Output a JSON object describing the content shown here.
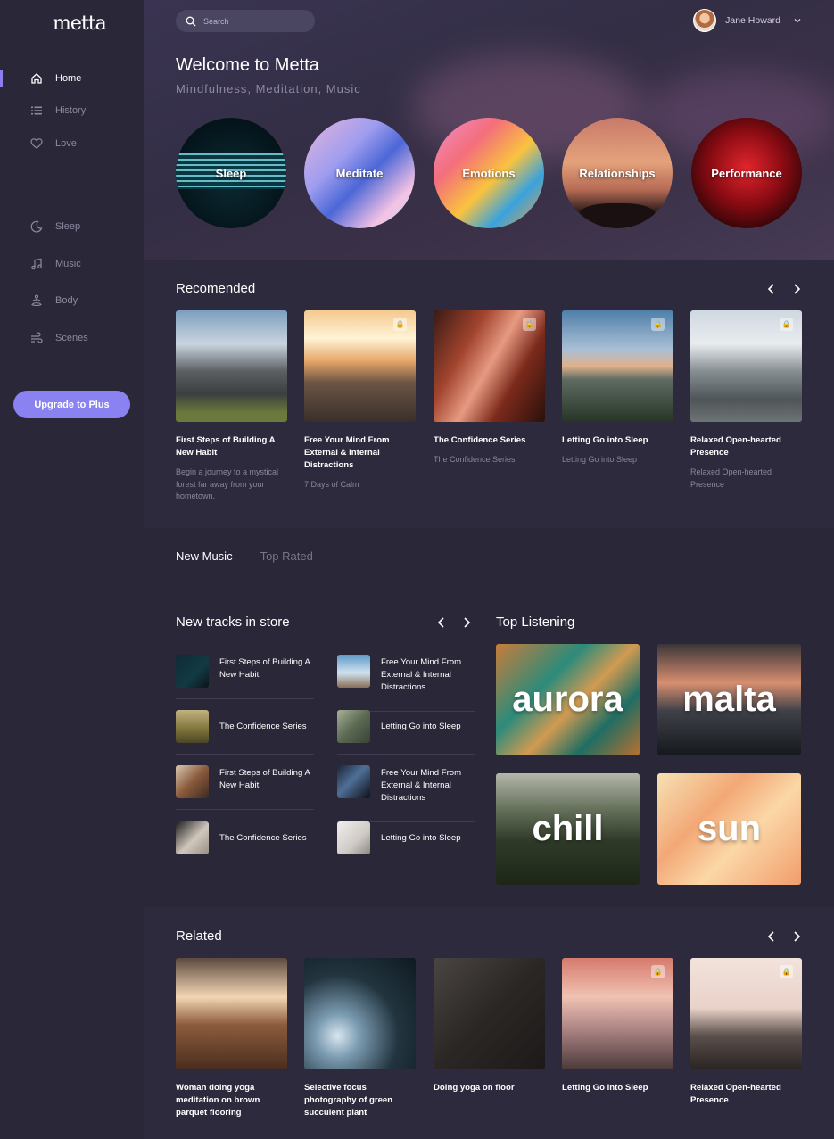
{
  "app": {
    "logo": "metta"
  },
  "sidebar": {
    "items": [
      {
        "label": "Home",
        "icon": "home-icon",
        "active": true
      },
      {
        "label": "History",
        "icon": "list-icon",
        "active": false
      },
      {
        "label": "Love",
        "icon": "heart-icon",
        "active": false
      },
      {
        "label": "Sleep",
        "icon": "moon-icon",
        "active": false
      },
      {
        "label": "Music",
        "icon": "music-note-icon",
        "active": false
      },
      {
        "label": "Body",
        "icon": "meditation-body-icon",
        "active": false
      },
      {
        "label": "Scenes",
        "icon": "wind-icon",
        "active": false
      }
    ],
    "upgrade_label": "Upgrade to Plus"
  },
  "header": {
    "search_placeholder": "Search",
    "user_name": "Jane Howard",
    "welcome": "Welcome to Metta",
    "subtitle": "Mindfulness, Meditation, Music"
  },
  "categories": [
    "Sleep",
    "Meditate",
    "Emotions",
    "Relationships",
    "Performance"
  ],
  "recommended": {
    "title": "Recomended",
    "cards": [
      {
        "title": "First Steps of Building A New Habit",
        "desc": "Begin a journey to a mystical forest far away from your hometown.",
        "locked": false
      },
      {
        "title": "Free Your Mind From External & Internal Distractions",
        "desc": "7 Days of Calm",
        "locked": true
      },
      {
        "title": "The Confidence Series",
        "desc": "The Confidence Series",
        "locked": true
      },
      {
        "title": "Letting Go into Sleep",
        "desc": "Letting Go into Sleep",
        "locked": true
      },
      {
        "title": "Relaxed Open-hearted Presence",
        "desc": "Relaxed Open-hearted Presence",
        "locked": true
      }
    ]
  },
  "music": {
    "tabs": [
      "New Music",
      "Top Rated"
    ],
    "active_tab": "New Music",
    "tracks_title": "New tracks in store",
    "tracks": [
      "First Steps of Building A New Habit",
      "Free Your Mind From External & Internal Distractions",
      "The Confidence Series",
      "Letting Go into Sleep",
      "First Steps of Building A New Habit",
      "Free Your Mind From External & Internal Distractions",
      "The Confidence Series",
      "Letting Go into Sleep"
    ],
    "top_title": "Top Listening",
    "top_tiles": [
      "aurora",
      "malta",
      "chill",
      "sun"
    ]
  },
  "related": {
    "title": "Related",
    "cards": [
      {
        "title": "Woman doing yoga meditation on brown parquet flooring",
        "locked": false
      },
      {
        "title": "Selective focus photography of green succulent plant",
        "locked": false
      },
      {
        "title": "Doing yoga on floor",
        "locked": false
      },
      {
        "title": "Letting Go into Sleep",
        "locked": true
      },
      {
        "title": "Relaxed Open-hearted Presence",
        "locked": true
      }
    ]
  },
  "colors": {
    "accent": "#8b82f2",
    "background": "#2a2738",
    "panel": "#302c41"
  }
}
